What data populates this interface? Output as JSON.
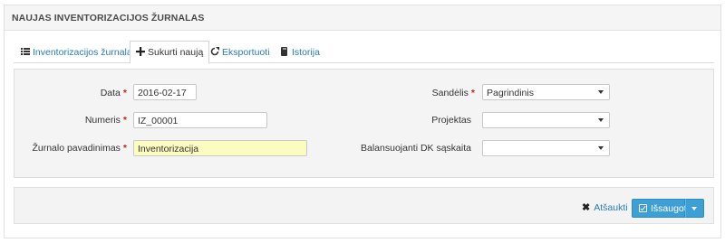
{
  "panel": {
    "title": "NAUJAS INVENTORIZACIJOS ŽURNALAS"
  },
  "tabs": [
    {
      "label": "Inventorizacijos žurnalai",
      "icon": "list-icon",
      "active": false
    },
    {
      "label": "Sukurti naują",
      "icon": "plus-icon",
      "active": true
    },
    {
      "label": "Eksportuoti",
      "icon": "export-icon",
      "active": false
    },
    {
      "label": "Istorija",
      "icon": "book-icon",
      "active": false
    }
  ],
  "form": {
    "date": {
      "label": "Data",
      "value": "2016-02-17",
      "required": true
    },
    "number": {
      "label": "Numeris",
      "value": "IZ_00001",
      "required": true
    },
    "journal_name": {
      "label": "Žurnalo pavadinimas",
      "value": "Inventorizacija",
      "required": true
    },
    "warehouse": {
      "label": "Sandėlis",
      "value": "Pagrindinis",
      "required": true
    },
    "project": {
      "label": "Projektas",
      "value": "",
      "required": false
    },
    "dk_account": {
      "label": "Balansuojanti DK sąskaita",
      "value": "",
      "required": false
    },
    "required_mark": "*"
  },
  "actions": {
    "cancel_label": "Atšaukti",
    "save_label": "Išsaugoti"
  },
  "colors": {
    "link": "#2a7bb8",
    "primary_button": "#3c9fd6",
    "required": "#cc2222",
    "highlight_input": "#fbfcc0"
  }
}
